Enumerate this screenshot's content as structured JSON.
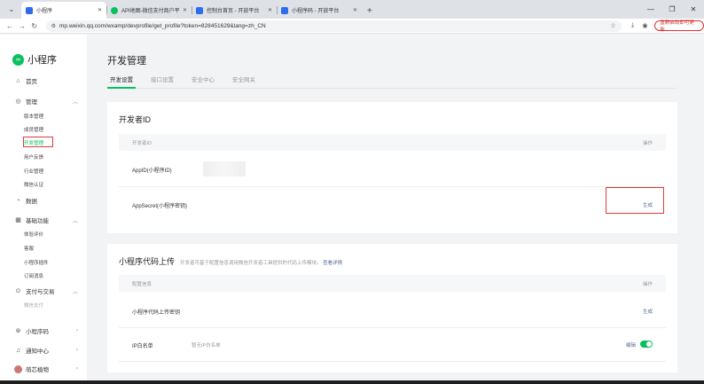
{
  "browser": {
    "tabs": [
      {
        "title": "小程序",
        "active": true,
        "color": "#2b6cf2"
      },
      {
        "title": "API地图-微信支付商户平台",
        "active": false,
        "color": "#07c160"
      },
      {
        "title": "控制台首页 - 开放平台",
        "active": false,
        "color": "#2b6cf2"
      },
      {
        "title": "小程序码 - 开放平台",
        "active": false,
        "color": "#2b6cf2"
      }
    ],
    "new_tab": "+",
    "url": "mp.weixin.qq.com/wxamp/devprofile/get_profile?token=828451629&lang=zh_CN",
    "update_button": "重新启动即可更新"
  },
  "sidebar": {
    "logo_text": "小程序",
    "home": "首页",
    "manage": "管理",
    "manage_items": [
      "版本管理",
      "成员管理",
      "开发管理",
      "用户反馈",
      "行业管理",
      "微信认证"
    ],
    "data": "数据",
    "basic": "基础功能",
    "basic_items": [
      "体验评价",
      "客服",
      "小程序插件",
      "订阅消息"
    ],
    "pay": "支付与交易",
    "pay_items": [
      "微信支付"
    ],
    "qrcode": "小程序码",
    "notify": "通知中心",
    "account": "萌芯植物"
  },
  "main": {
    "title": "开发管理",
    "tabs": [
      "开发设置",
      "接口设置",
      "安全中心",
      "安全网关"
    ],
    "dev_id": {
      "title": "开发者ID",
      "col_left": "开发者ID",
      "col_right": "操作",
      "rows": [
        {
          "label": "AppID(小程序ID)",
          "action": ""
        },
        {
          "label": "AppSecret(小程序密钥)",
          "action": "生成"
        }
      ]
    },
    "upload": {
      "title": "小程序代码上传",
      "desc": "开发者可基于配置信息调用微信开发者工具提供的代码上传模块。",
      "desc_link": "查看详情",
      "col_left": "配置信息",
      "col_right": "操作",
      "rows": [
        {
          "label": "小程序代码上传密钥",
          "value": "",
          "action": "生成"
        },
        {
          "label": "IP白名单",
          "value": "暂无IP白名单",
          "action": "编辑"
        }
      ]
    }
  }
}
